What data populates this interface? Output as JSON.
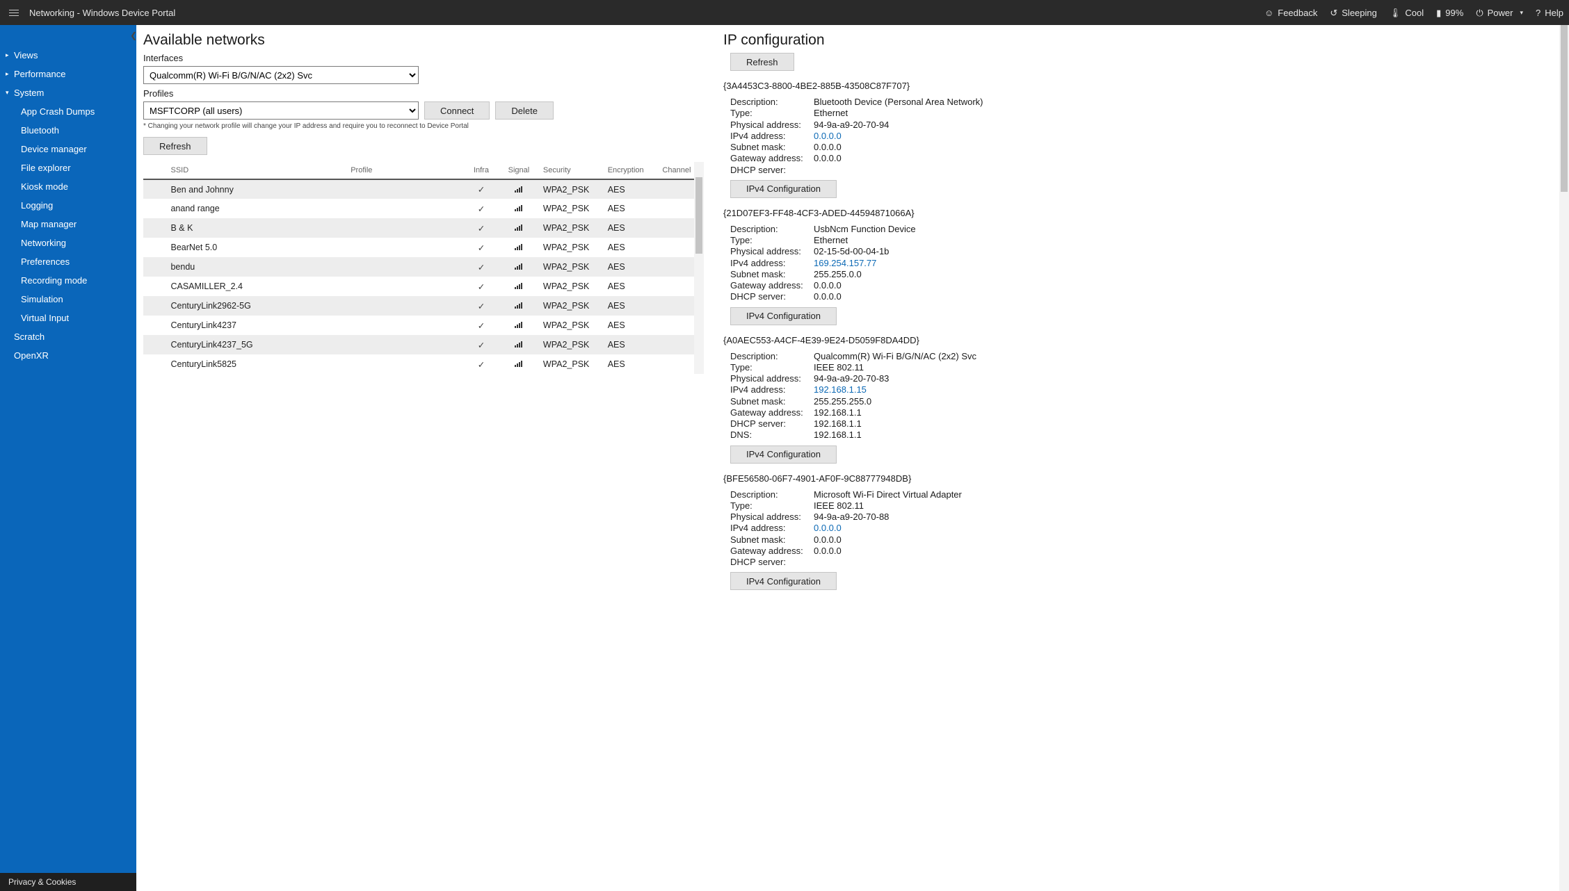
{
  "header": {
    "title": "Networking - Windows Device Portal",
    "feedback": "Feedback",
    "sleeping": "Sleeping",
    "cool": "Cool",
    "battery": "99%",
    "power": "Power",
    "help": "Help"
  },
  "sidebar": {
    "nodes": [
      {
        "label": "Views",
        "expanded": false,
        "children": []
      },
      {
        "label": "Performance",
        "expanded": false,
        "children": []
      },
      {
        "label": "System",
        "expanded": true,
        "children": [
          {
            "label": "App Crash Dumps"
          },
          {
            "label": "Bluetooth"
          },
          {
            "label": "Device manager"
          },
          {
            "label": "File explorer"
          },
          {
            "label": "Kiosk mode"
          },
          {
            "label": "Logging"
          },
          {
            "label": "Map manager"
          },
          {
            "label": "Networking",
            "active": true
          },
          {
            "label": "Preferences"
          },
          {
            "label": "Recording mode"
          },
          {
            "label": "Simulation"
          },
          {
            "label": "Virtual Input"
          }
        ]
      },
      {
        "label": "Scratch",
        "expanded": null,
        "children": []
      },
      {
        "label": "OpenXR",
        "expanded": null,
        "children": []
      }
    ],
    "footer": "Privacy & Cookies"
  },
  "networks": {
    "heading": "Available networks",
    "interfaces_label": "Interfaces",
    "interfaces_value": "Qualcomm(R) Wi-Fi B/G/N/AC (2x2) Svc",
    "profiles_label": "Profiles",
    "profiles_value": "MSFTCORP (all users)",
    "connect": "Connect",
    "delete": "Delete",
    "note": "* Changing your network profile will change your IP address and require you to reconnect to Device Portal",
    "refresh": "Refresh",
    "cols": {
      "ssid": "SSID",
      "profile": "Profile",
      "infra": "Infra",
      "signal": "Signal",
      "security": "Security",
      "encryption": "Encryption",
      "channel": "Channel"
    },
    "rows": [
      {
        "ssid": "Ben and Johnny",
        "security": "WPA2_PSK",
        "encryption": "AES"
      },
      {
        "ssid": "anand range",
        "security": "WPA2_PSK",
        "encryption": "AES"
      },
      {
        "ssid": "B & K",
        "security": "WPA2_PSK",
        "encryption": "AES"
      },
      {
        "ssid": "BearNet 5.0",
        "security": "WPA2_PSK",
        "encryption": "AES"
      },
      {
        "ssid": "bendu",
        "security": "WPA2_PSK",
        "encryption": "AES"
      },
      {
        "ssid": "CASAMILLER_2.4",
        "security": "WPA2_PSK",
        "encryption": "AES"
      },
      {
        "ssid": "CenturyLink2962-5G",
        "security": "WPA2_PSK",
        "encryption": "AES"
      },
      {
        "ssid": "CenturyLink4237",
        "security": "WPA2_PSK",
        "encryption": "AES"
      },
      {
        "ssid": "CenturyLink4237_5G",
        "security": "WPA2_PSK",
        "encryption": "AES"
      },
      {
        "ssid": "CenturyLink5825",
        "security": "WPA2_PSK",
        "encryption": "AES"
      }
    ]
  },
  "ipconfig": {
    "heading": "IP configuration",
    "refresh": "Refresh",
    "ipv4btn": "IPv4 Configuration",
    "labels": {
      "description": "Description:",
      "type": "Type:",
      "physical": "Physical address:",
      "ipv4": "IPv4 address:",
      "subnet": "Subnet mask:",
      "gateway": "Gateway address:",
      "dhcp": "DHCP server:",
      "dns": "DNS:"
    },
    "adapters": [
      {
        "guid": "{3A4453C3-8800-4BE2-885B-43508C87F707}",
        "description": "Bluetooth Device (Personal Area Network)",
        "type": "Ethernet",
        "physical": "94-9a-a9-20-70-94",
        "ipv4": "0.0.0.0",
        "subnet": "0.0.0.0",
        "gateway": "0.0.0.0",
        "dhcp": ""
      },
      {
        "guid": "{21D07EF3-FF48-4CF3-ADED-44594871066A}",
        "description": "UsbNcm Function Device",
        "type": "Ethernet",
        "physical": "02-15-5d-00-04-1b",
        "ipv4": "169.254.157.77",
        "subnet": "255.255.0.0",
        "gateway": "0.0.0.0",
        "dhcp": "0.0.0.0"
      },
      {
        "guid": "{A0AEC553-A4CF-4E39-9E24-D5059F8DA4DD}",
        "description": "Qualcomm(R) Wi-Fi B/G/N/AC (2x2) Svc",
        "type": "IEEE 802.11",
        "physical": "94-9a-a9-20-70-83",
        "ipv4": "192.168.1.15",
        "subnet": "255.255.255.0",
        "gateway": "192.168.1.1",
        "dhcp": "192.168.1.1",
        "dns": "192.168.1.1"
      },
      {
        "guid": "{BFE56580-06F7-4901-AF0F-9C88777948DB}",
        "description": "Microsoft Wi-Fi Direct Virtual Adapter",
        "type": "IEEE 802.11",
        "physical": "94-9a-a9-20-70-88",
        "ipv4": "0.0.0.0",
        "subnet": "0.0.0.0",
        "gateway": "0.0.0.0",
        "dhcp": ""
      }
    ]
  }
}
